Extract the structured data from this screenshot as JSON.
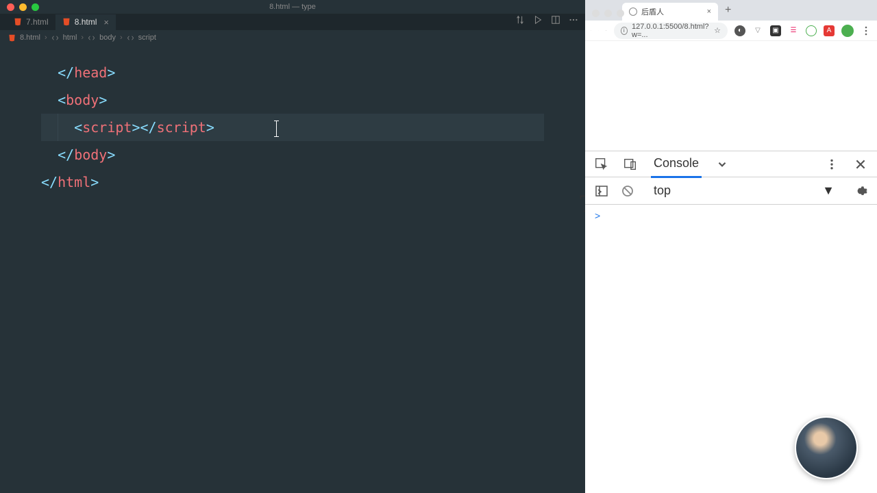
{
  "window": {
    "title": "8.html — type"
  },
  "tabs": [
    {
      "label": "7.html",
      "active": false
    },
    {
      "label": "8.html",
      "active": true
    }
  ],
  "breadcrumb": [
    "8.html",
    "html",
    "body",
    "script"
  ],
  "code": {
    "l1": {
      "open": "</",
      "name": "head",
      "close": ">"
    },
    "l2": {
      "open": "<",
      "name": "body",
      "close": ">"
    },
    "l3": {
      "open1": "<",
      "name1": "script",
      "mid": "></",
      "name2": "script",
      "close": ">"
    },
    "l4": {
      "open": "</",
      "name": "body",
      "close": ">"
    },
    "l5": {
      "open": "</",
      "name": "html",
      "close": ">"
    }
  },
  "browser": {
    "tab_title": "后盾人",
    "url": "127.0.0.1:5500/8.html?w=...",
    "page_edge": "T"
  },
  "devtools": {
    "tab": "Console",
    "context": "top",
    "prompt": ">"
  }
}
